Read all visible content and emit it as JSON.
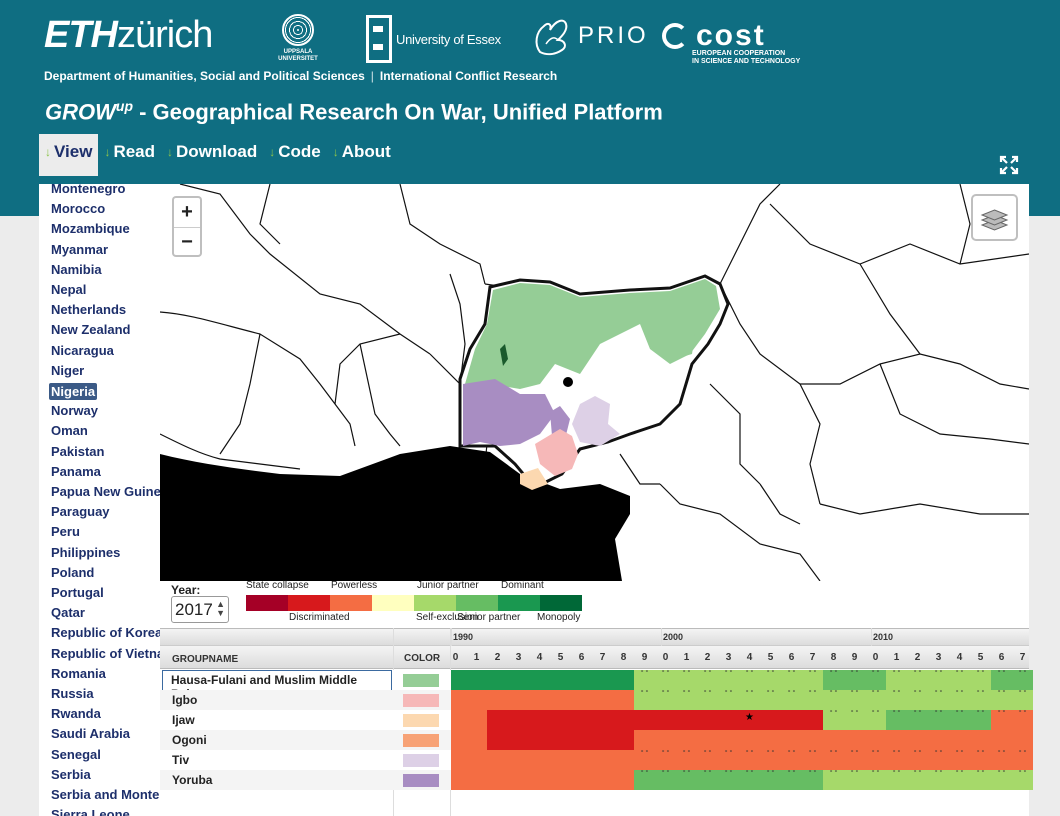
{
  "header": {
    "eth_bold": "ETH",
    "eth_light": "zürich",
    "uppsala": [
      "UPPSALA",
      "UNIVERSITET"
    ],
    "essex": "University of Essex",
    "prio": "PRIO",
    "cost_word": "cost",
    "cost_sub": [
      "EUROPEAN COOPERATION",
      "IN SCIENCE AND TECHNOLOGY"
    ],
    "dept_left": "Department of Humanities, Social and Political Sciences",
    "dept_sep": "|",
    "dept_right": "International Conflict Research",
    "title_grow": "GROW",
    "title_sup": "up",
    "title_rest": " - Geographical Research On War, Unified Platform"
  },
  "nav": [
    {
      "label": "View",
      "active": true
    },
    {
      "label": "Read",
      "active": false
    },
    {
      "label": "Download",
      "active": false
    },
    {
      "label": "Code",
      "active": false
    },
    {
      "label": "About",
      "active": false
    }
  ],
  "icons": {
    "nav_arrow": "down-arrow-icon",
    "fullscreen": "expand-icon",
    "layers": "layers-icon",
    "zoom_in": "+",
    "zoom_out": "−"
  },
  "sidebar": {
    "selected": "Nigeria",
    "countries": [
      "Montenegro",
      "Morocco",
      "Mozambique",
      "Myanmar",
      "Namibia",
      "Nepal",
      "Netherlands",
      "New Zealand",
      "Nicaragua",
      "Niger",
      "Nigeria",
      "Norway",
      "Oman",
      "Pakistan",
      "Panama",
      "Papua New Guinea",
      "Paraguay",
      "Peru",
      "Philippines",
      "Poland",
      "Portugal",
      "Qatar",
      "Republic of Korea",
      "Republic of Vietnam",
      "Romania",
      "Russia",
      "Rwanda",
      "Saudi Arabia",
      "Senegal",
      "Serbia",
      "Serbia and Montenegro",
      "Sierra Leone"
    ]
  },
  "controls": {
    "year_label": "Year:",
    "year_value": "2017",
    "legend": [
      {
        "label": "State collapse",
        "color": "#a50026",
        "row": "top"
      },
      {
        "label": "Discriminated",
        "color": "#d7191c",
        "row": "bottom"
      },
      {
        "label": "Powerless",
        "color": "#f46d43",
        "row": "top"
      },
      {
        "label": "Self-exclusion",
        "color": "#ffffbf",
        "row": "bottom"
      },
      {
        "label": "Junior partner",
        "color": "#a6d96a",
        "row": "top"
      },
      {
        "label": "Senior partner",
        "color": "#66bd63",
        "row": "bottom"
      },
      {
        "label": "Dominant",
        "color": "#1a9850",
        "row": "top"
      },
      {
        "label": "Monopoly",
        "color": "#006837",
        "row": "bottom"
      }
    ]
  },
  "table": {
    "col_groupname": "GROUPNAME",
    "col_color": "COLOR",
    "decades": [
      "1990",
      "2000",
      "2010"
    ],
    "year_digits": [
      "0",
      "1",
      "2",
      "3",
      "4",
      "5",
      "6",
      "7",
      "8",
      "9",
      "0",
      "1",
      "2",
      "3",
      "4",
      "5",
      "6",
      "7",
      "8",
      "9",
      "0",
      "1",
      "2",
      "3",
      "4",
      "5",
      "6",
      "7"
    ],
    "status_colors": {
      "P": "#f46d43",
      "D": "#d7191c",
      "J": "#a6d96a",
      "S": "#66bd63",
      "M": "#1a9850"
    },
    "rows": [
      {
        "name": "Hausa-Fulani and Muslim Middle Belt",
        "color": "#95cd96",
        "selected": true,
        "statuses": [
          "M",
          "M",
          "M",
          "M",
          "M",
          "M",
          "M",
          "M",
          "M",
          "J",
          "J",
          "J",
          "J",
          "J",
          "J",
          "J",
          "J",
          "J",
          "S",
          "S",
          "S",
          "J",
          "J",
          "J",
          "J",
          "J",
          "S",
          "S"
        ],
        "markers": "000000000111111111111111111111"
      },
      {
        "name": "Igbo",
        "color": "#f6b8b8",
        "selected": false,
        "statuses": [
          "P",
          "P",
          "P",
          "P",
          "P",
          "P",
          "P",
          "P",
          "P",
          "J",
          "J",
          "J",
          "J",
          "J",
          "J",
          "J",
          "J",
          "J",
          "J",
          "J",
          "J",
          "J",
          "J",
          "J",
          "J",
          "J",
          "J",
          "J"
        ],
        "markers": "000000000111111111111111111111"
      },
      {
        "name": "Ijaw",
        "color": "#fcd8b0",
        "selected": false,
        "statuses": [
          "P",
          "P",
          "D",
          "D",
          "D",
          "D",
          "D",
          "D",
          "D",
          "D",
          "D",
          "D",
          "D",
          "D",
          "D",
          "D",
          "D",
          "D",
          "J",
          "J",
          "J",
          "S",
          "S",
          "S",
          "S",
          "S",
          "P",
          "P"
        ],
        "markers": "000000000000000000111111111111",
        "star_index": 14
      },
      {
        "name": "Ogoni",
        "color": "#f7a276",
        "selected": false,
        "statuses": [
          "P",
          "P",
          "D",
          "D",
          "D",
          "D",
          "D",
          "D",
          "D",
          "P",
          "P",
          "P",
          "P",
          "P",
          "P",
          "P",
          "P",
          "P",
          "P",
          "P",
          "P",
          "P",
          "P",
          "P",
          "P",
          "P",
          "P",
          "P"
        ],
        "markers": "0000000000000000000000000000"
      },
      {
        "name": "Tiv",
        "color": "#ddd0e6",
        "selected": false,
        "statuses": [
          "P",
          "P",
          "P",
          "P",
          "P",
          "P",
          "P",
          "P",
          "P",
          "P",
          "P",
          "P",
          "P",
          "P",
          "P",
          "P",
          "P",
          "P",
          "P",
          "P",
          "P",
          "P",
          "P",
          "P",
          "P",
          "P",
          "P",
          "P"
        ],
        "markers": "000000000111111111111111111111"
      },
      {
        "name": "Yoruba",
        "color": "#a88dc2",
        "selected": false,
        "statuses": [
          "P",
          "P",
          "P",
          "P",
          "P",
          "P",
          "P",
          "P",
          "P",
          "S",
          "S",
          "S",
          "S",
          "S",
          "S",
          "S",
          "S",
          "S",
          "J",
          "J",
          "J",
          "J",
          "J",
          "J",
          "J",
          "J",
          "J",
          "J"
        ],
        "markers": "000000000111111111111111111111"
      }
    ]
  }
}
